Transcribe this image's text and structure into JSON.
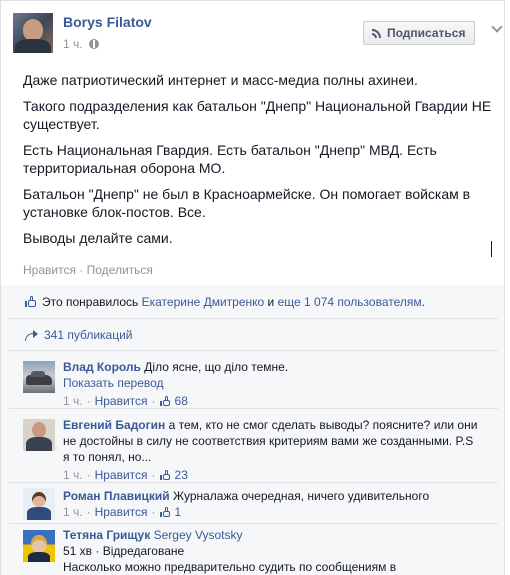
{
  "post": {
    "author": "Borys Filatov",
    "time": "1 ч.",
    "subscribe_label": "Подписаться",
    "paragraphs": [
      "Даже патриотический интернет и масс-медиа полны ахинеи.",
      "Такого подразделения как батальон \"Днепр\" Национальной Гвардии НЕ существует.",
      "Есть Национальная Гвардия. Есть батальон \"Днепр\" МВД. Есть территориальная оборона МО.",
      "Батальон \"Днепр\" не был в Красноармейске. Он помогает войскам в установке блок-постов. Все.",
      "Выводы делайте сами."
    ],
    "like_label": "Нравится",
    "separator": " · ",
    "share_label": "Поделиться"
  },
  "ufi": {
    "likes_prefix": "Это понравилось ",
    "likes_person": "Екатерине Дмитренко",
    "likes_and": " и ",
    "likes_more": "еще 1 074 пользователям",
    "likes_suffix": ".",
    "shares_label": "341 публикаций"
  },
  "comments": [
    {
      "name": "Влад Король",
      "text": "Діло ясне, що діло темне.",
      "translate": "Показать перевод",
      "time": "1 ч.",
      "like": "Нравится",
      "count": "68",
      "avatar": "car-icon"
    },
    {
      "name": "Евгений Бадогин",
      "text": "а тем, кто не смог сделать выводы? поясните? или они не достойны в силу не соответствия критериям вами же созданными. P.S я то понял, но...",
      "time": "1 ч.",
      "like": "Нравится",
      "count": "23",
      "avatar": "person-suit-icon"
    },
    {
      "name": "Роман Плавицкий",
      "text": "Журналажа очередная, ничего удивительного",
      "time": "1 ч.",
      "like": "Нравится",
      "count": "1",
      "avatar": "person-kid-icon"
    },
    {
      "name": "Тетяна Грищук",
      "tag": "Sergey Vysotsky",
      "time": "51 хв",
      "edited": "Відредаговане",
      "text": "Насколько можно предварительно судить по сообщениям в",
      "avatar": "person-flag-icon"
    }
  ],
  "colors": {
    "link": "#3b5998",
    "meta": "#90949c",
    "ufi_bg": "#f6f7f9"
  }
}
